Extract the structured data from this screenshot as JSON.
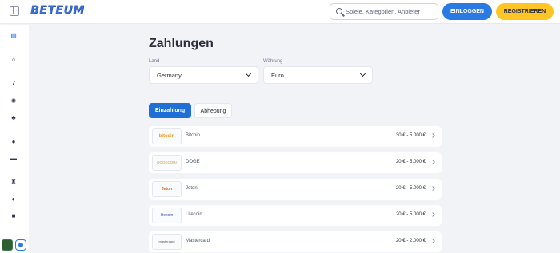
{
  "header": {
    "logo": "BETEUM",
    "search_placeholder": "Spiele, Kategorien, Anbieter",
    "login_label": "EINLOGGEN",
    "register_label": "REGISTRIEREN"
  },
  "sidebar": {
    "icons": [
      "casino-icon",
      "home-icon",
      "seven-icon",
      "sports-icon",
      "clover-icon",
      "football-icon",
      "esports-icon",
      "trophy-icon",
      "promo-icon",
      "gift-icon"
    ]
  },
  "page": {
    "title": "Zahlungen",
    "country_label": "Land",
    "country_value": "Germany",
    "currency_label": "Währung",
    "currency_value": "Euro"
  },
  "tabs": {
    "deposit": "Einzahlung",
    "withdraw": "Abhebung"
  },
  "payments": [
    {
      "logo": "bitcoin",
      "name": "Bitcoin",
      "limit": "30 € - 5.000 €"
    },
    {
      "logo": "DOGECOIN",
      "name": "DOGE",
      "limit": "20 € - 5.000 €"
    },
    {
      "logo": "Jeton",
      "name": "Jeton",
      "limit": "20 € - 5.000 €"
    },
    {
      "logo": "litecoin",
      "name": "Litecoin",
      "limit": "20 € - 5.000 €"
    },
    {
      "logo": "mastercard",
      "name": "Mastercard",
      "limit": "20 € - 2.000 €"
    }
  ]
}
